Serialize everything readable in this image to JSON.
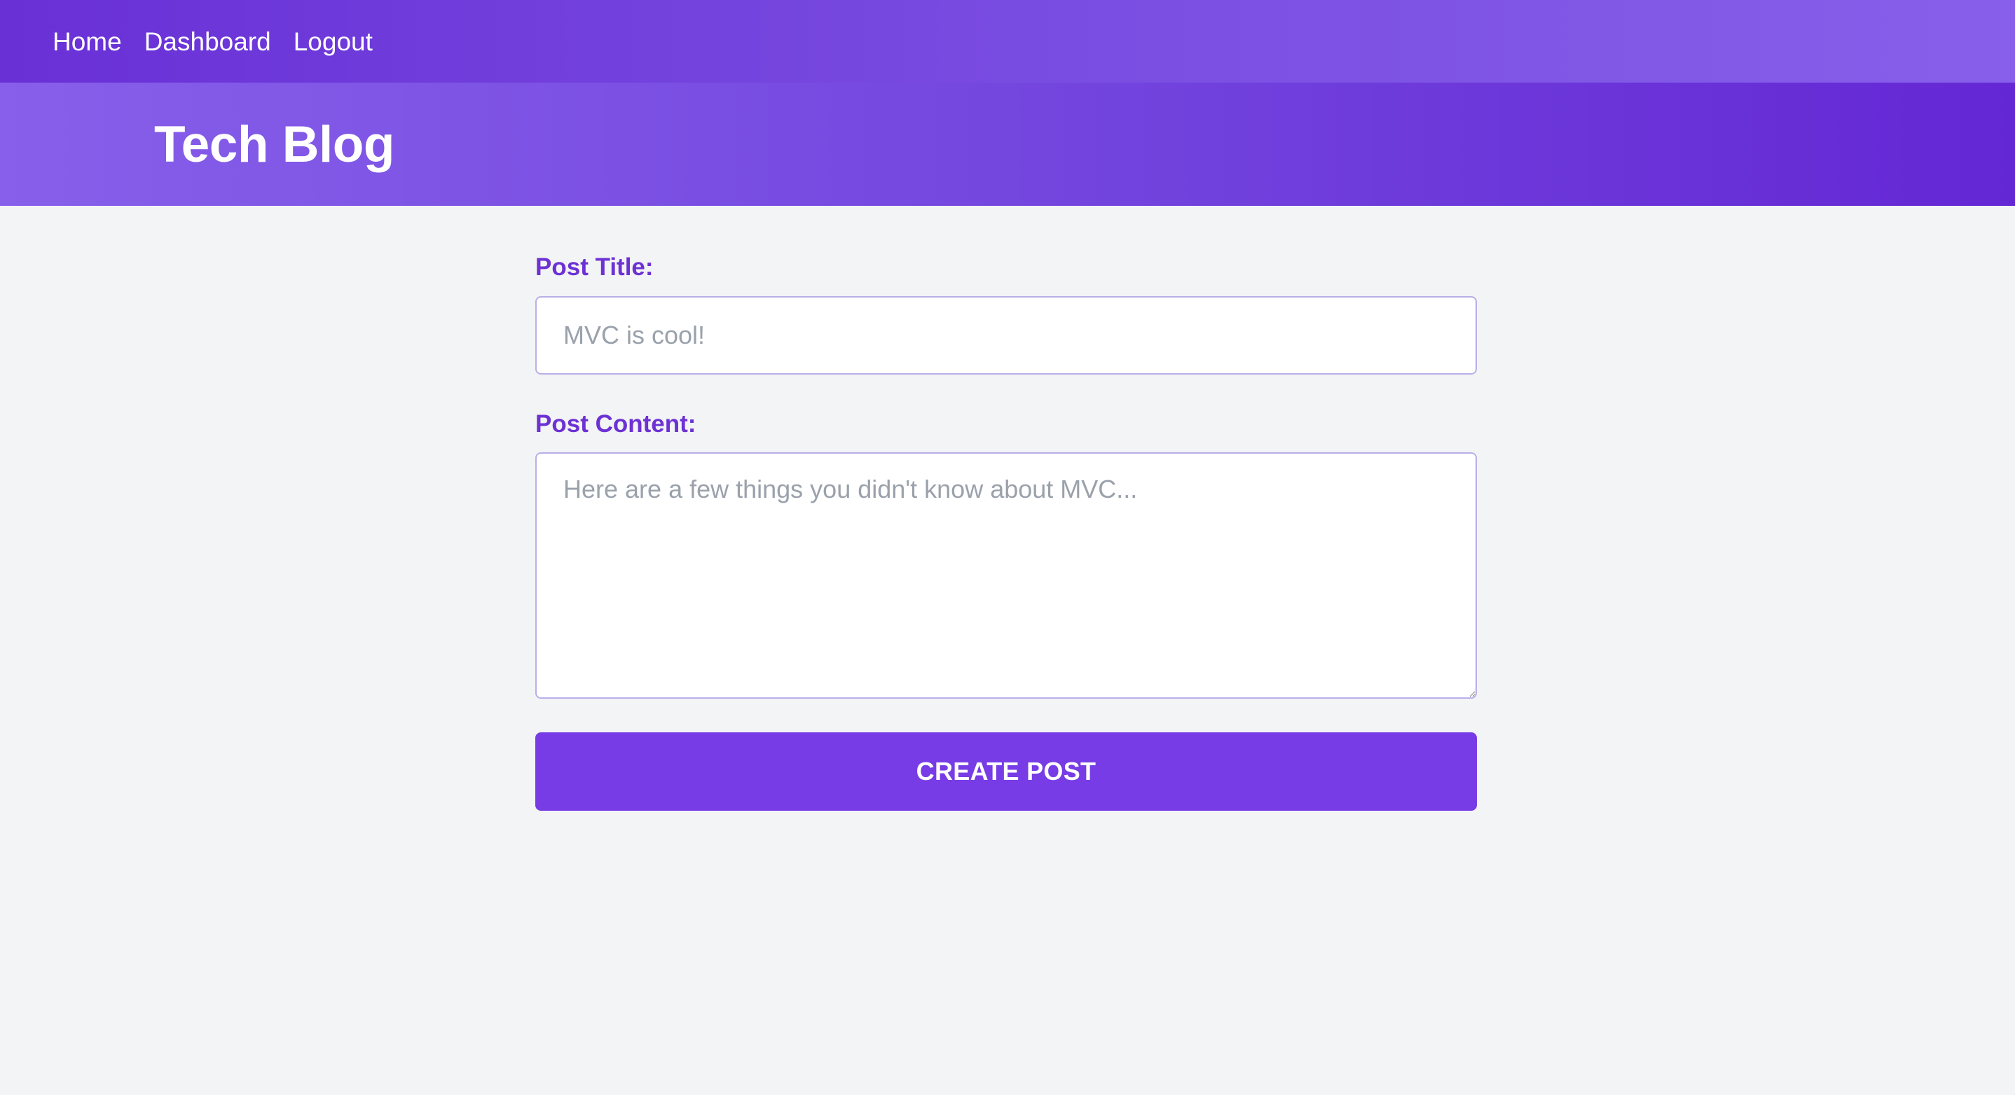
{
  "nav": {
    "items": [
      {
        "label": "Home"
      },
      {
        "label": "Dashboard"
      },
      {
        "label": "Logout"
      }
    ]
  },
  "header": {
    "title": "Tech Blog"
  },
  "form": {
    "title_label": "Post Title:",
    "title_placeholder": "MVC is cool!",
    "title_value": "",
    "content_label": "Post Content:",
    "content_placeholder": "Here are a few things you didn't know about MVC...",
    "content_value": "",
    "submit_label": "CREATE POST"
  },
  "colors": {
    "accent": "#773ce6",
    "label": "#6d31d4",
    "background": "#f2f4f5",
    "nav_gradient_start": "#6930d6",
    "nav_gradient_end": "#875fea",
    "hero_gradient_start": "#875fea",
    "hero_gradient_end": "#6427d4"
  }
}
